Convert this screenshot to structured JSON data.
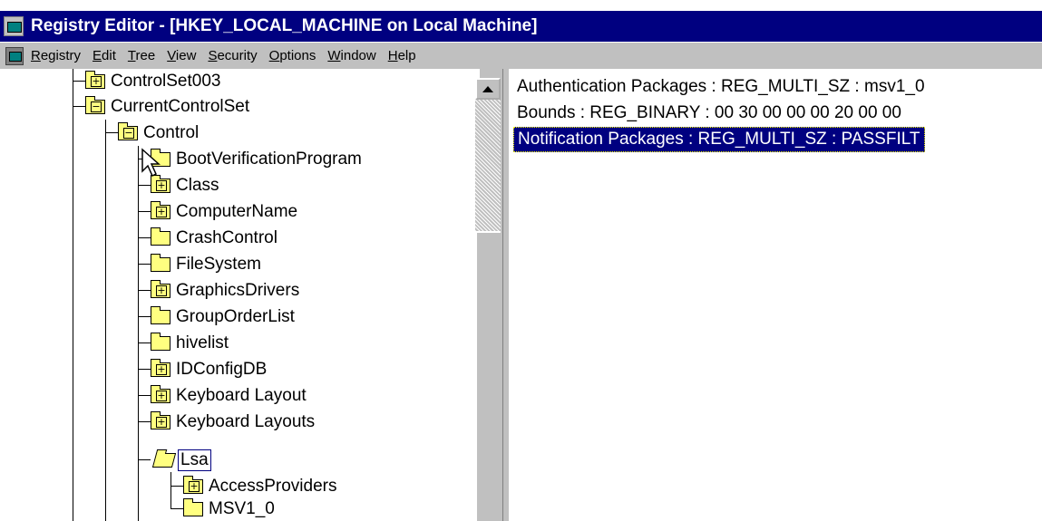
{
  "window": {
    "title": "Registry Editor - [HKEY_LOCAL_MACHINE on Local Machine]"
  },
  "menu": {
    "items": [
      "Registry",
      "Edit",
      "Tree",
      "View",
      "Security",
      "Options",
      "Window",
      "Help"
    ],
    "accelerators": [
      "R",
      "E",
      "T",
      "V",
      "S",
      "O",
      "W",
      "H"
    ]
  },
  "tree": {
    "nodes": [
      {
        "label": "ControlSet003",
        "state": "collapsed"
      },
      {
        "label": "CurrentControlSet",
        "state": "expanded"
      },
      {
        "label": "Control",
        "state": "expanded"
      },
      {
        "label": "BootVerificationProgram",
        "state": "leaf"
      },
      {
        "label": "Class",
        "state": "collapsed"
      },
      {
        "label": "ComputerName",
        "state": "collapsed"
      },
      {
        "label": "CrashControl",
        "state": "leaf"
      },
      {
        "label": "FileSystem",
        "state": "leaf"
      },
      {
        "label": "GraphicsDrivers",
        "state": "collapsed"
      },
      {
        "label": "GroupOrderList",
        "state": "leaf"
      },
      {
        "label": "hivelist",
        "state": "leaf"
      },
      {
        "label": "IDConfigDB",
        "state": "collapsed"
      },
      {
        "label": "Keyboard Layout",
        "state": "collapsed"
      },
      {
        "label": "Keyboard Layouts",
        "state": "collapsed"
      },
      {
        "label": "Lsa",
        "state": "open-selected"
      },
      {
        "label": "AccessProviders",
        "state": "collapsed"
      },
      {
        "label": "MSV1_0",
        "state": "leaf"
      }
    ]
  },
  "values": {
    "rows": [
      {
        "text": "Authentication Packages : REG_MULTI_SZ : msv1_0",
        "selected": false
      },
      {
        "text": "Bounds : REG_BINARY : 00 30 00 00 00 20 00 00",
        "selected": false
      },
      {
        "text": "Notification Packages : REG_MULTI_SZ : PASSFILT",
        "selected": true
      }
    ]
  },
  "colors": {
    "titlebar": "#000080",
    "selection": "#000080",
    "folder": "#ffff80",
    "chrome": "#c0c0c0"
  }
}
